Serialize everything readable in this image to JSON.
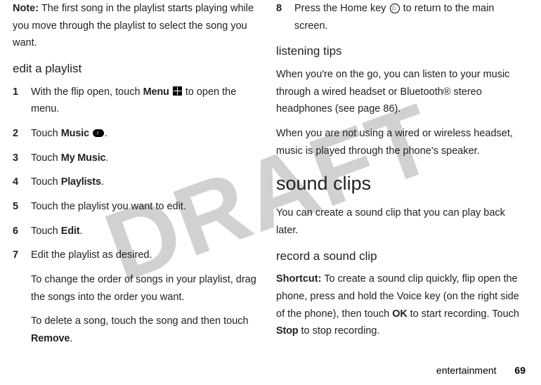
{
  "watermark": "DRAFT",
  "left": {
    "note_label": "Note:",
    "note_body": " The first song in the playlist starts playing while you move through the playlist to select the song you want.",
    "heading_edit": "edit a playlist",
    "step1_a": "With the flip open, touch ",
    "step1_menu": "Menu",
    "step1_b": " to open the menu.",
    "step2_a": "Touch ",
    "step2_music": "Music",
    "step3_a": "Touch ",
    "step3_b": "My Music",
    "step4_a": "Touch ",
    "step4_b": "Playlists",
    "step5": "Touch the playlist you want to edit.",
    "step6_a": "Touch ",
    "step6_b": "Edit",
    "step7_a": "Edit the playlist as desired.",
    "step7_b": "To change the order of songs in your playlist, drag the songs into the order you want.",
    "step7_c_a": "To delete a song, touch the song and then touch ",
    "step7_c_b": "Remove"
  },
  "right": {
    "step8_a": "Press the Home key ",
    "step8_b": " to return to the main screen.",
    "heading_tips": "listening tips",
    "tips_p1": "When you're on the go, you can listen to your music through a wired headset or Bluetooth® stereo headphones (see page 86).",
    "tips_p2": "When you are not using a wired or wireless headset, music is played through the phone's speaker.",
    "heading_sound": "sound clips",
    "sound_p1": "You can create a sound clip that you can play back later.",
    "heading_record": "record a sound clip",
    "shortcut_label": "Shortcut:",
    "shortcut_a": " To create a sound clip quickly, flip open the phone, press and hold the Voice key (on the right side of the phone), then touch ",
    "shortcut_ok": "OK",
    "shortcut_b": " to start recording. Touch ",
    "shortcut_stop": "Stop",
    "shortcut_c": " to stop recording."
  },
  "footer": {
    "section": "entertainment",
    "page": "69"
  },
  "nums": {
    "n1": "1",
    "n2": "2",
    "n3": "3",
    "n4": "4",
    "n5": "5",
    "n6": "6",
    "n7": "7",
    "n8": "8"
  },
  "punct": {
    "period": "."
  }
}
